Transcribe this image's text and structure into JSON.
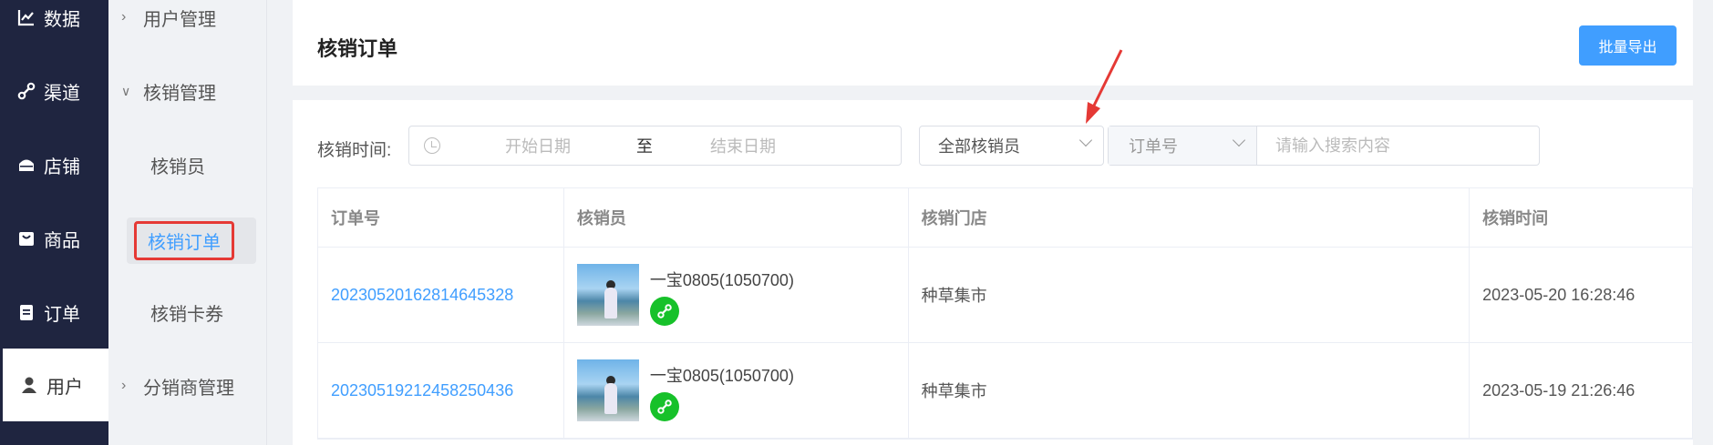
{
  "nav": {
    "items": [
      {
        "label": "数据",
        "icon": "chart-line-icon"
      },
      {
        "label": "渠道",
        "icon": "link-icon"
      },
      {
        "label": "店铺",
        "icon": "store-icon"
      },
      {
        "label": "商品",
        "icon": "bag-icon"
      },
      {
        "label": "订单",
        "icon": "clipboard-icon"
      },
      {
        "label": "用户",
        "icon": "user-icon"
      }
    ],
    "active": "用户"
  },
  "submenu": {
    "items": [
      {
        "label": "用户管理",
        "type": "group",
        "state": "collapsed"
      },
      {
        "label": "核销管理",
        "type": "group",
        "state": "expanded"
      },
      {
        "label": "核销员",
        "type": "leaf"
      },
      {
        "label": "核销订单",
        "type": "leaf",
        "active": true
      },
      {
        "label": "核销卡券",
        "type": "leaf"
      },
      {
        "label": "分销商管理",
        "type": "group",
        "state": "collapsed"
      }
    ]
  },
  "header": {
    "title": "核销订单",
    "export_label": "批量导出"
  },
  "filters": {
    "time_label": "核销时间:",
    "start_placeholder": "开始日期",
    "range_sep": "至",
    "end_placeholder": "结束日期",
    "staff_select": "全部核销员",
    "search_type": "订单号",
    "search_placeholder": "请输入搜索内容"
  },
  "table": {
    "columns": [
      "订单号",
      "核销员",
      "核销门店",
      "核销时间"
    ],
    "rows": [
      {
        "order_no": "20230520162814645328",
        "staff": "一宝0805(1050700)",
        "store": "种草集市",
        "time": "2023-05-20 16:28:46"
      },
      {
        "order_no": "20230519212458250436",
        "staff": "一宝0805(1050700)",
        "store": "种草集市",
        "time": "2023-05-19 21:26:46"
      }
    ]
  },
  "colors": {
    "nav_bg": "#1f2540",
    "accent": "#409eff",
    "highlight_box": "#e53935",
    "arrow": "#e53935",
    "wechat_badge": "#17c12a"
  }
}
